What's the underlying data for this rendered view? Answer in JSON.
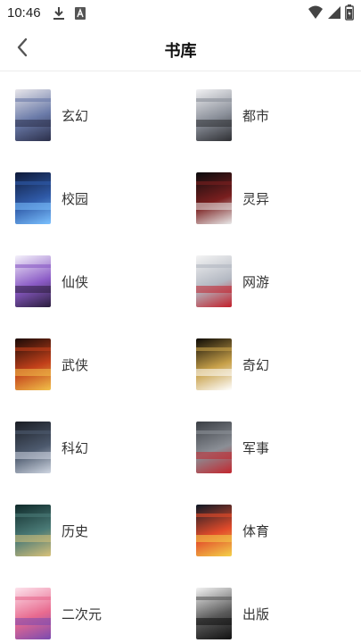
{
  "status": {
    "time": "10:46",
    "icons": [
      "download-icon",
      "a-box-icon",
      "wifi-icon",
      "signal-icon",
      "battery-icon"
    ]
  },
  "header": {
    "title": "书库",
    "back_icon": "chevron-left-icon"
  },
  "categories": [
    {
      "label": "玄幻",
      "colors": [
        "#e8e6ea",
        "#6a7aa8",
        "#2b2f4a"
      ]
    },
    {
      "label": "都市",
      "colors": [
        "#f1f1f3",
        "#8a8f99",
        "#2e2f33"
      ]
    },
    {
      "label": "校园",
      "colors": [
        "#0e1a3a",
        "#2f5aa8",
        "#7bc1ff"
      ]
    },
    {
      "label": "灵异",
      "colors": [
        "#0b0b0d",
        "#7a1f1f",
        "#e9e9e9"
      ]
    },
    {
      "label": "仙侠",
      "colors": [
        "#f5f2fb",
        "#8b5bc6",
        "#2b1e3d"
      ]
    },
    {
      "label": "网游",
      "colors": [
        "#f4f4f4",
        "#b3b8c2",
        "#c21f2a"
      ]
    },
    {
      "label": "武侠",
      "colors": [
        "#1a0a07",
        "#c2401a",
        "#f2c14a"
      ]
    },
    {
      "label": "奇幻",
      "colors": [
        "#0d0a05",
        "#c8a14a",
        "#ffffff"
      ]
    },
    {
      "label": "科幻",
      "colors": [
        "#1a1d24",
        "#4d5a6e",
        "#cfd6e2"
      ]
    },
    {
      "label": "军事",
      "colors": [
        "#3b3f45",
        "#8b8f96",
        "#c3262e"
      ]
    },
    {
      "label": "历史",
      "colors": [
        "#0f2a2a",
        "#4a7a76",
        "#d9c27a"
      ]
    },
    {
      "label": "体育",
      "colors": [
        "#0d1826",
        "#e24b2a",
        "#f4d24a"
      ]
    },
    {
      "label": "二次元",
      "colors": [
        "#fde3ec",
        "#e86a8f",
        "#7a4ab0"
      ]
    },
    {
      "label": "出版",
      "colors": [
        "#f3f3f3",
        "#5a5a5a",
        "#111111"
      ]
    }
  ]
}
